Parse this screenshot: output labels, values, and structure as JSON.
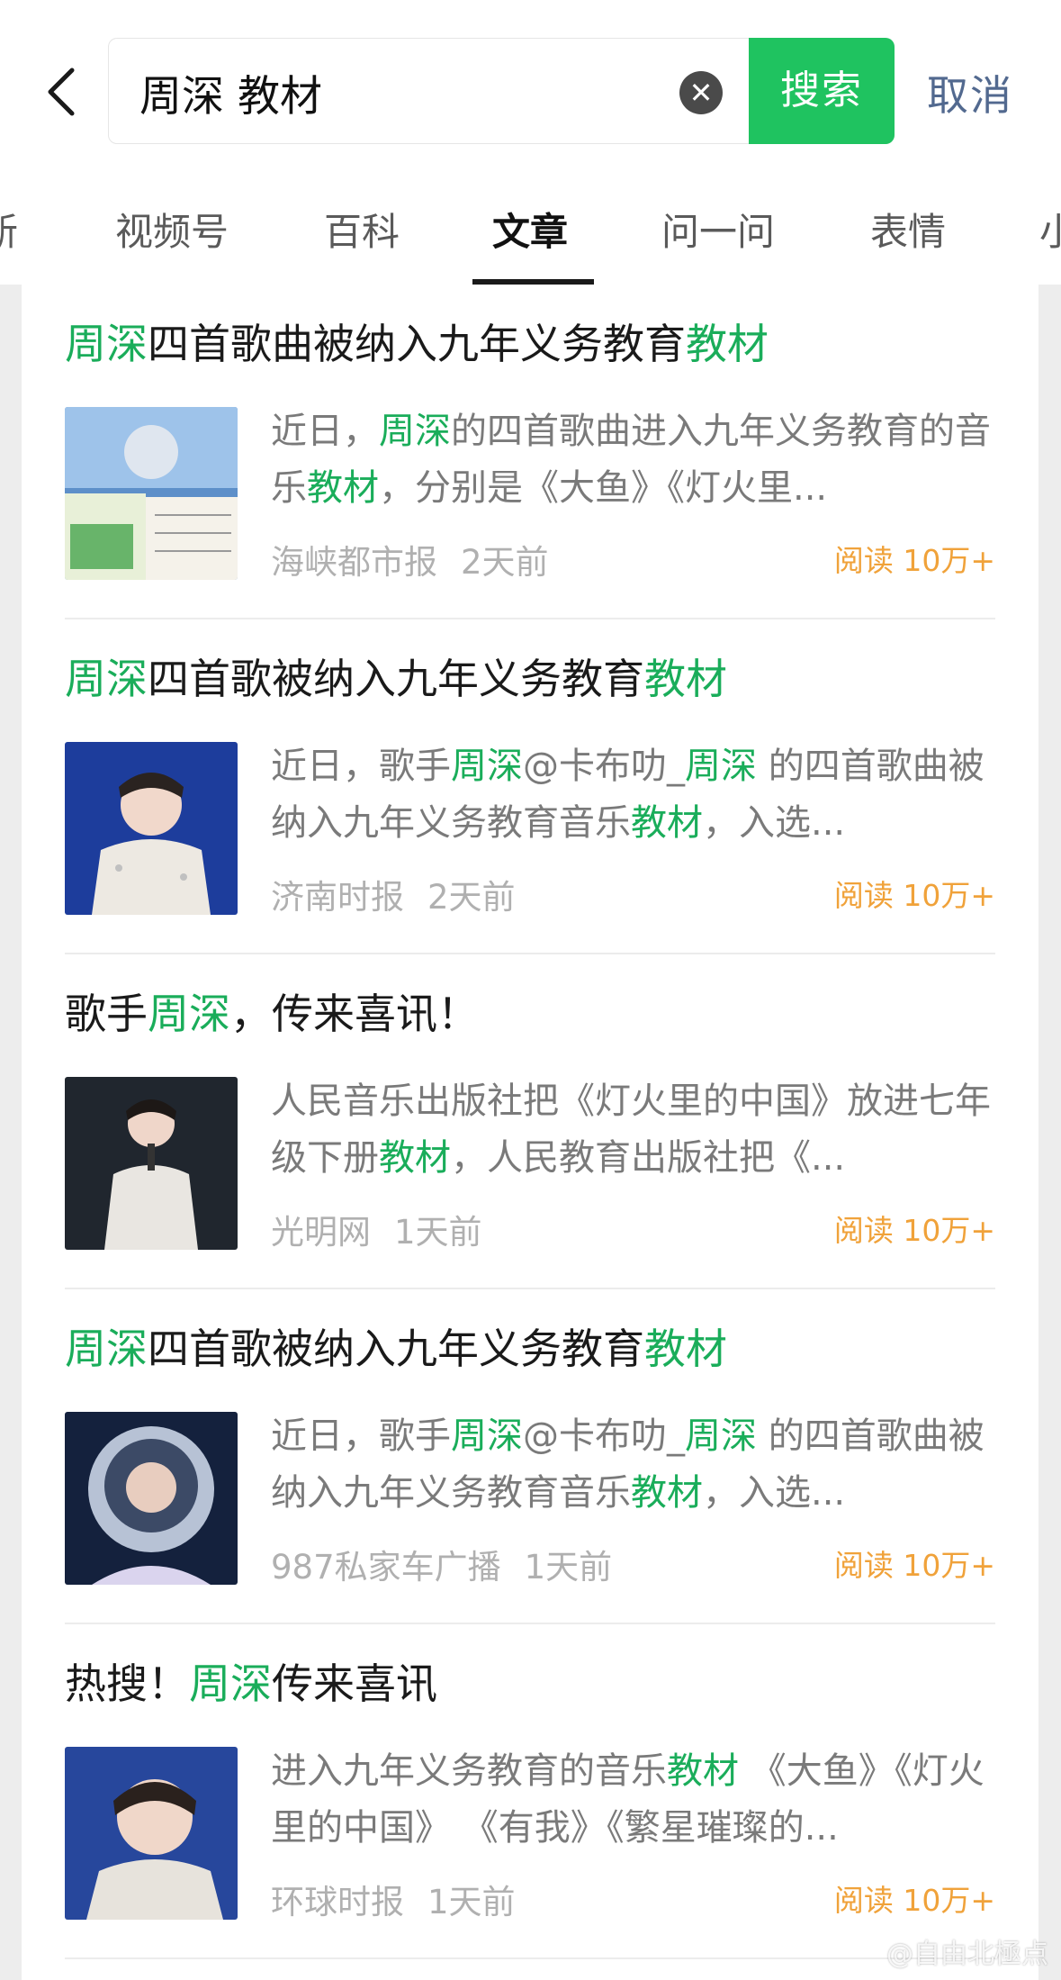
{
  "search": {
    "query": "周深 教材",
    "button_label": "搜索",
    "cancel_label": "取消"
  },
  "tabs": [
    "新",
    "视频号",
    "百科",
    "文章",
    "问一问",
    "表情",
    "小"
  ],
  "active_tab": "文章",
  "colors": {
    "accent_green": "#1fc360",
    "highlight": "#1aad5a",
    "reads_orange": "#f0a23a",
    "cancel_blue": "#52698f"
  },
  "results": [
    {
      "title": [
        {
          "t": "周深",
          "h": true
        },
        {
          "t": "四首歌曲被纳入九年义务教育",
          "h": false
        },
        {
          "t": "教材",
          "h": true
        }
      ],
      "snippet": [
        {
          "t": "近日，",
          "h": false
        },
        {
          "t": "周深",
          "h": true
        },
        {
          "t": "的四首歌曲进入九年义务教育的音乐",
          "h": false
        },
        {
          "t": "教材",
          "h": true
        },
        {
          "t": "，分别是《大鱼》《灯火里...",
          "h": false
        }
      ],
      "source": "海峡都市报",
      "time": "2天前",
      "reads": "阅读 10万+",
      "thumb": "book-photo"
    },
    {
      "title": [
        {
          "t": "周深",
          "h": true
        },
        {
          "t": "四首歌被纳入九年义务教育",
          "h": false
        },
        {
          "t": "教材",
          "h": true
        }
      ],
      "snippet": [
        {
          "t": "近日，歌手",
          "h": false
        },
        {
          "t": "周深",
          "h": true
        },
        {
          "t": "@卡布叻_",
          "h": false
        },
        {
          "t": "周深",
          "h": true
        },
        {
          "t": " 的四首歌曲被纳入九年义务教育音乐",
          "h": false
        },
        {
          "t": "教材",
          "h": true
        },
        {
          "t": "，入选...",
          "h": false
        }
      ],
      "source": "济南时报",
      "time": "2天前",
      "reads": "阅读 10万+",
      "thumb": "stage-photo"
    },
    {
      "title": [
        {
          "t": "歌手",
          "h": false
        },
        {
          "t": "周深",
          "h": true
        },
        {
          "t": "，传来喜讯！",
          "h": false
        }
      ],
      "snippet": [
        {
          "t": "人民音乐出版社把《灯火里的中国》放进七年级下册",
          "h": false
        },
        {
          "t": "教材",
          "h": true
        },
        {
          "t": "，人民教育出版社把《...",
          "h": false
        }
      ],
      "source": "光明网",
      "time": "1天前",
      "reads": "阅读 10万+",
      "thumb": "singer-photo"
    },
    {
      "title": [
        {
          "t": "周深",
          "h": true
        },
        {
          "t": "四首歌被纳入九年义务教育",
          "h": false
        },
        {
          "t": "教材",
          "h": true
        }
      ],
      "snippet": [
        {
          "t": "近日，歌手",
          "h": false
        },
        {
          "t": "周深",
          "h": true
        },
        {
          "t": "@卡布叻_",
          "h": false
        },
        {
          "t": "周深",
          "h": true
        },
        {
          "t": " 的四首歌曲被纳入九年义务教育音乐",
          "h": false
        },
        {
          "t": "教材",
          "h": true
        },
        {
          "t": "，入选...",
          "h": false
        }
      ],
      "source": "987私家车广播",
      "time": "1天前",
      "reads": "阅读 10万+",
      "thumb": "astronaut-photo"
    },
    {
      "title": [
        {
          "t": "热搜！",
          "h": false
        },
        {
          "t": "周深",
          "h": true
        },
        {
          "t": "传来喜讯",
          "h": false
        }
      ],
      "snippet": [
        {
          "t": "进入九年义务教育的音乐",
          "h": false
        },
        {
          "t": "教材",
          "h": true
        },
        {
          "t": " 《大鱼》《灯火里的中国》 《有我》《繁星璀璨的...",
          "h": false
        }
      ],
      "source": "环球时报",
      "time": "1天前",
      "reads": "阅读 10万+",
      "thumb": "portrait-photo"
    }
  ],
  "watermark": "@自由北極点"
}
